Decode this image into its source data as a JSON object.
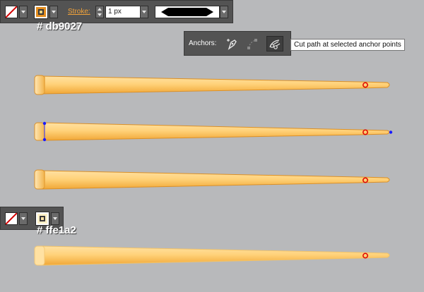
{
  "top_toolbar": {
    "fill_swatch": "none",
    "stroke_swatch_color": "#db9027",
    "stroke_label": "Stroke:",
    "stroke_weight": "1 px",
    "brush_preview": "uniform-profile"
  },
  "color_labels": {
    "first": "# db9027",
    "second": "# ffe1a2"
  },
  "anchors_panel": {
    "label": "Anchors:",
    "tooltip": "Cut path at selected anchor points",
    "buttons": [
      "convert-anchor-icon",
      "remove-anchor-icon",
      "cut-path-icon"
    ]
  },
  "second_toolbar": {
    "fill_swatch": "none",
    "stroke_swatch_color": "#ffe1a2"
  },
  "colors": {
    "stroke_dark": "#db9027",
    "fill_light": "#ffe1a2",
    "anchor_selected": "#e00000",
    "anchor_point": "#1a1aff"
  }
}
